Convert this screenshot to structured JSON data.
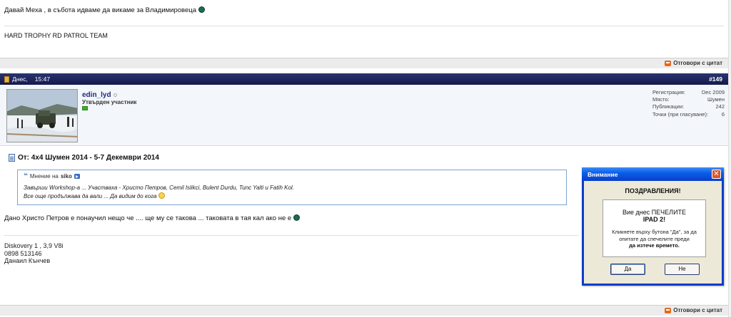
{
  "prev_post": {
    "message": "Давай Меха , в събота идваме да викаме за Владимировеца",
    "signature": "HARD TROPHY RD PATROL TEAM",
    "quote_label": "Отговори с цитат"
  },
  "post": {
    "date": "Днес,",
    "time": "15:47",
    "number": "#149",
    "username": "edin_lyd",
    "user_title": "Утвърден участник",
    "stats": [
      {
        "label": "Регистрация:",
        "value": "Dec 2009"
      },
      {
        "label": "Място:",
        "value": "Шумен"
      },
      {
        "label": "Публикации:",
        "value": "242"
      },
      {
        "label": "Точки (при гласуване):",
        "value": "6"
      }
    ],
    "title": "От: 4x4 Шумен 2014 - 5-7 Декември 2014",
    "quote": {
      "prefix": "Мнение на",
      "author": "siko",
      "line1": "Завърши Workshop-а ... Участваха - Христо Петров, Cemil Islikci, Bulent Durdu, Tunc Yalti и Fatih Kol.",
      "line2": "Все още продължава да вали ... Да видим до кога"
    },
    "message": "Дано Христо Петров е понаучил нещо че .... ще му се такова ... таковата в тая кал ако не е",
    "signature": [
      "Diskovery 1 , 3,9 V8i",
      "0898 513146",
      "Данаил Кънчев"
    ],
    "quote_label": "Отговори с цитат"
  },
  "dialog": {
    "title": "Внимание",
    "headline": "ПОЗДРАВЛЕНИЯ!",
    "line1": "Вие днес ПЕЧЕЛИТЕ",
    "line2": "IPAD 2!",
    "line3": "Кликнете върху бутона \"Да\", за да",
    "line4": "опитате да спечелите преди",
    "line5": "да изтече времето.",
    "yes": "Да",
    "no": "Не"
  }
}
